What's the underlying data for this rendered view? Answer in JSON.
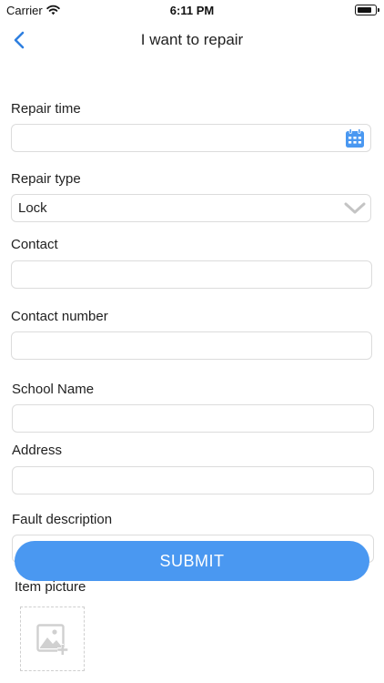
{
  "status_bar": {
    "carrier": "Carrier",
    "time": "6:11 PM",
    "battery_level": 0.85
  },
  "nav": {
    "title": "I want to repair",
    "back_icon": "chevron-left-icon"
  },
  "form": {
    "repair_time": {
      "label": "Repair time",
      "value": "",
      "icon": "calendar-icon"
    },
    "repair_type": {
      "label": "Repair type",
      "value": "Lock",
      "icon": "chevron-down-icon"
    },
    "contact": {
      "label": "Contact",
      "value": ""
    },
    "contact_number": {
      "label": "Contact number",
      "value": ""
    },
    "school_name": {
      "label": "School Name",
      "value": ""
    },
    "address": {
      "label": "Address",
      "value": ""
    },
    "fault_description": {
      "label": "Fault description",
      "value": ""
    },
    "item_picture": {
      "label": "Item picture",
      "icon": "add-image-icon"
    }
  },
  "submit": {
    "label": "SUBMIT"
  },
  "colors": {
    "accent": "#4a98f1",
    "border": "#dcdcdc",
    "calendar_icon": "#4a98f1",
    "chevron": "#c4c4c4"
  }
}
